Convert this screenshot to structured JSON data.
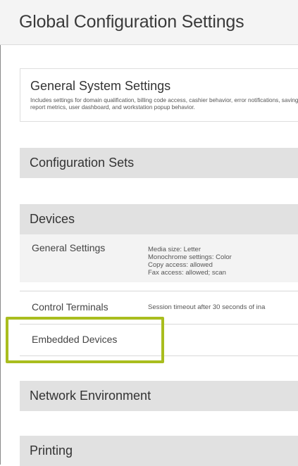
{
  "page": {
    "title": "Global Configuration Settings"
  },
  "general_system": {
    "title": "General System Settings",
    "description": "Includes settings for domain qualification, billing code access, cashier behavior, error notifications, savings report metrics, user dashboard, and workstation popup behavior."
  },
  "sections": {
    "configuration_sets": "Configuration Sets",
    "devices": "Devices",
    "network_environment": "Network Environment",
    "printing": "Printing"
  },
  "devices": {
    "general_settings": {
      "label": "General Settings",
      "details": [
        "Media size: Letter",
        "Monochrome settings: Color",
        "Copy access: allowed",
        "Fax access: allowed; scan"
      ]
    },
    "control_terminals": {
      "label": "Control Terminals",
      "detail": "Session timeout after 30 seconds of ina"
    },
    "embedded_devices": {
      "label": "Embedded Devices"
    }
  },
  "colors": {
    "section_bar": "#e1e1e1",
    "row_background": "#f3f3f3",
    "highlight": "#a9bd1e"
  }
}
